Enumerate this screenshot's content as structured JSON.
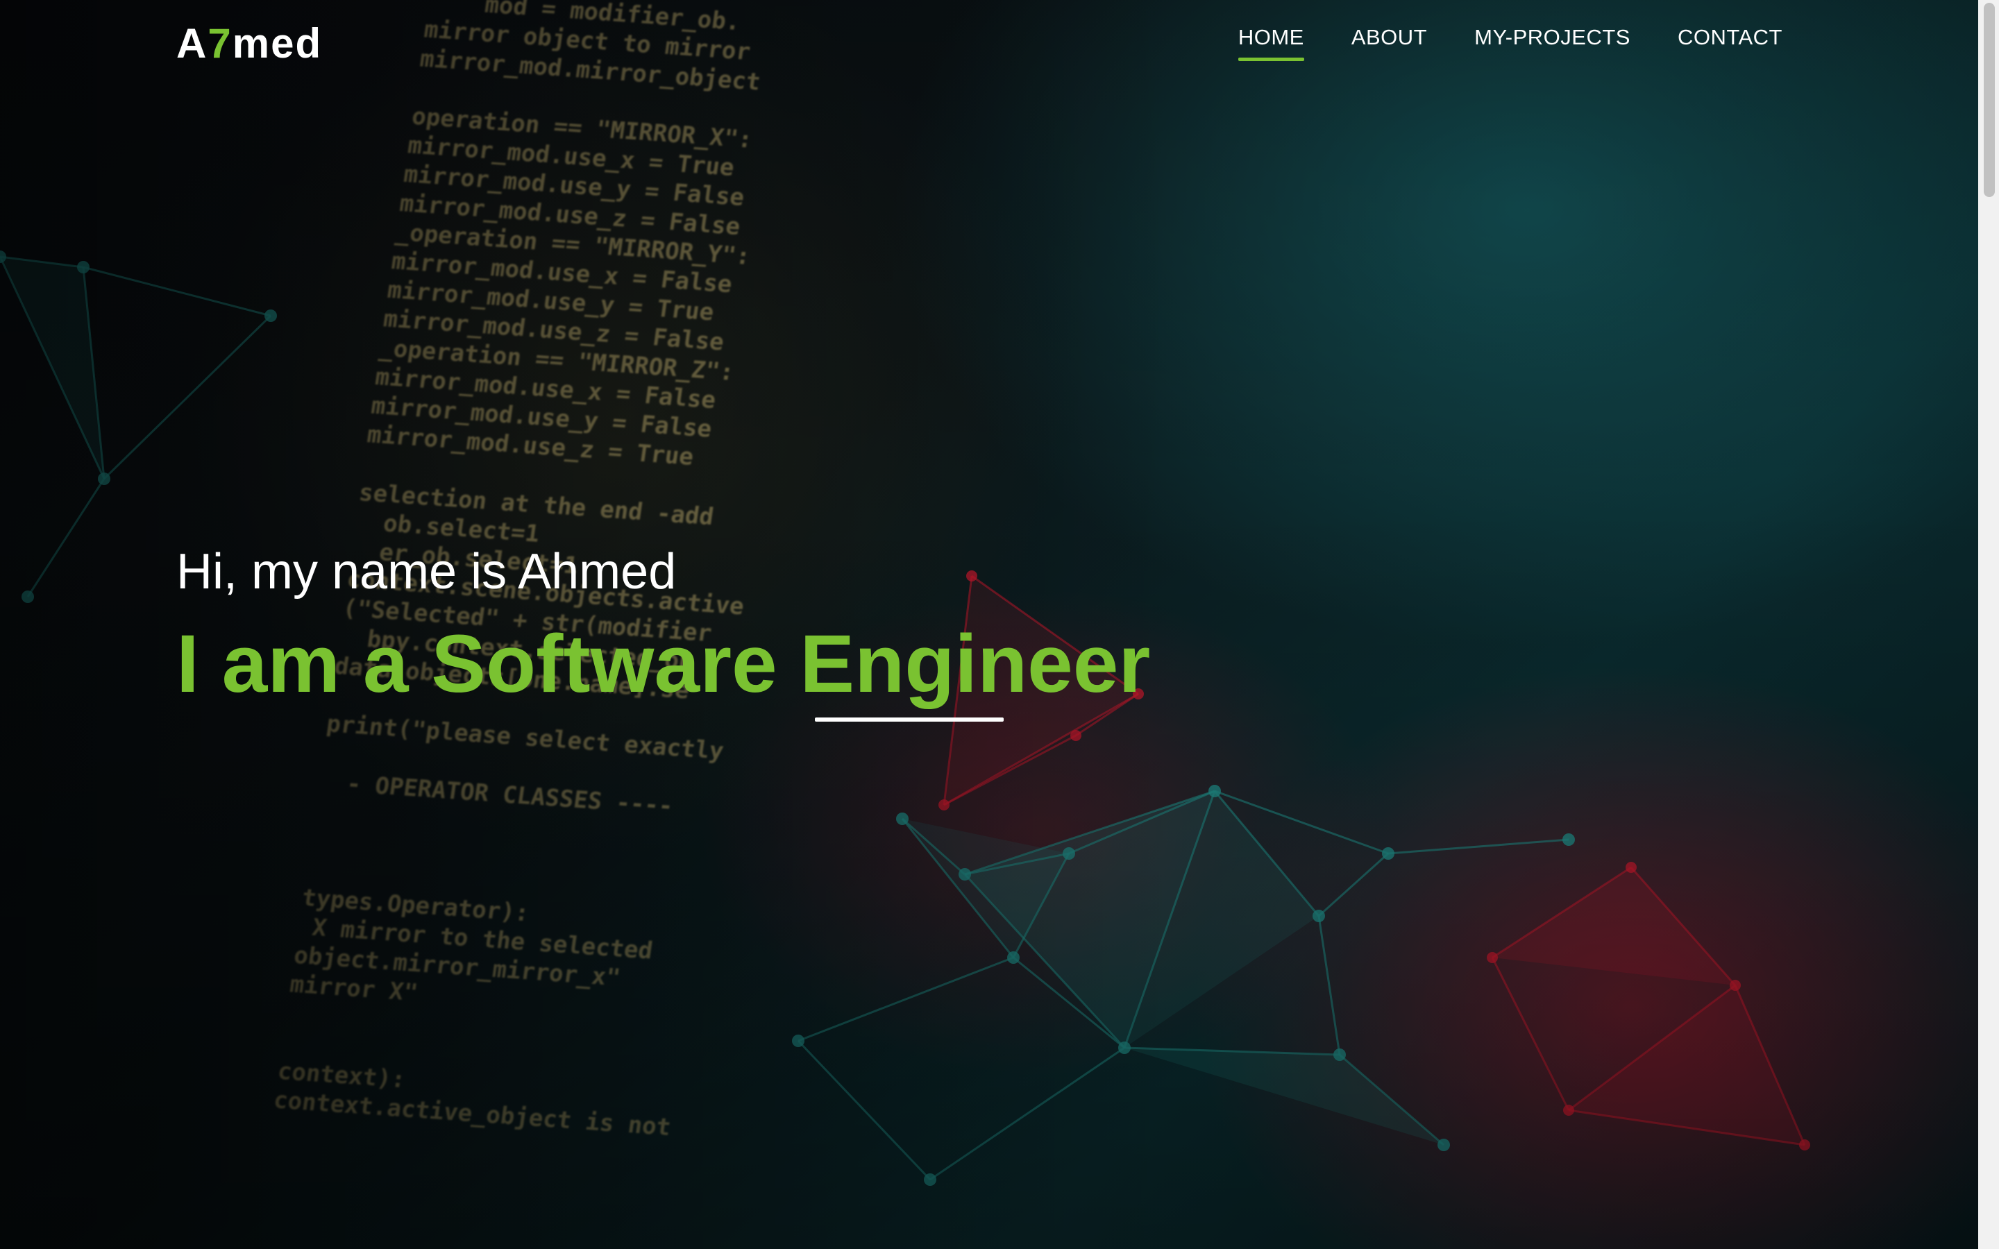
{
  "navbar": {
    "logo": {
      "part1": "A",
      "accent": "7",
      "part2": "med"
    },
    "links": [
      {
        "label": "HOME",
        "active": true
      },
      {
        "label": "ABOUT",
        "active": false
      },
      {
        "label": "MY-PROJECTS",
        "active": false
      },
      {
        "label": "CONTACT",
        "active": false
      }
    ]
  },
  "hero": {
    "greeting": "Hi, my name is Ahmed",
    "title": "I am a Software Engineer"
  },
  "background": {
    "code_lines": [
      "    mod = modifier_ob.",
      "mirror object to mirror",
      "mirror_mod.mirror_object",
      "",
      "operation == \"MIRROR_X\":",
      "mirror_mod.use_x = True",
      "mirror_mod.use_y = False",
      "mirror_mod.use_z = False",
      "_operation == \"MIRROR_Y\":",
      "mirror_mod.use_x = False",
      "mirror_mod.use_y = True",
      "mirror_mod.use_z = False",
      "_operation == \"MIRROR_Z\":",
      "mirror_mod.use_x = False",
      "mirror_mod.use_y = False",
      "mirror_mod.use_z = True",
      "",
      "selection at the end -add",
      "  ob.select=1",
      "  er_ob.select=1",
      "context.scene.objects.active",
      "(\"Selected\" + str(modifier",
      "  bpy.context.selected_ob",
      "data.objects[one.name].se",
      "",
      "print(\"please select exactly",
      "",
      "  - OPERATOR CLASSES ----",
      "",
      "",
      "",
      "types.Operator):",
      " X mirror to the selected",
      "object.mirror_mirror_x\"",
      "mirror X\"",
      "",
      "",
      "context):",
      "context.active_object is not"
    ],
    "colors": {
      "accent": "#7ac231",
      "text": "#ffffff",
      "teal": "#1f8a84",
      "red": "#c4182c"
    }
  }
}
